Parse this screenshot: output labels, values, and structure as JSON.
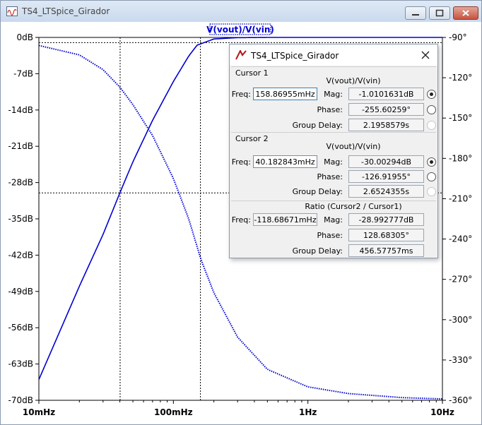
{
  "window": {
    "title": "TS4_LTSpice_Girador"
  },
  "plot": {
    "trace_label": "V(vout)/V(vin)",
    "trace_color": "#0000d0",
    "left_ticks": [
      "0dB",
      "-7dB",
      "-14dB",
      "-21dB",
      "-28dB",
      "-35dB",
      "-42dB",
      "-49dB",
      "-56dB",
      "-63dB",
      "-70dB"
    ],
    "right_ticks": [
      "-90°",
      "-120°",
      "-150°",
      "-180°",
      "-210°",
      "-240°",
      "-270°",
      "-300°",
      "-330°",
      "-360°"
    ],
    "x_ticks": [
      "10mHz",
      "100mHz",
      "1Hz",
      "10Hz"
    ],
    "cursor1_freq_hz": 0.15887,
    "cursor2_freq_hz": 0.04018
  },
  "chart_data": {
    "type": "line",
    "xscale": "log",
    "xlim": [
      0.01,
      10
    ],
    "ylim_left": [
      -70,
      0
    ],
    "ylim_right": [
      -360,
      -90
    ],
    "x_ticks": [
      "10mHz",
      "100mHz",
      "1Hz",
      "10Hz"
    ],
    "left_axis_ticks": [
      "0dB",
      "-7dB",
      "-14dB",
      "-21dB",
      "-28dB",
      "-35dB",
      "-42dB",
      "-49dB",
      "-56dB",
      "-63dB",
      "-70dB"
    ],
    "right_axis_ticks": [
      "-90°",
      "-120°",
      "-150°",
      "-180°",
      "-210°",
      "-240°",
      "-270°",
      "-300°",
      "-330°",
      "-360°"
    ],
    "series": [
      {
        "name": "V(vout)/V(vin)",
        "style": "solid",
        "axis": "left",
        "x": [
          0.01,
          0.02,
          0.03,
          0.04,
          0.05,
          0.07,
          0.1,
          0.13,
          0.15,
          0.2,
          0.3,
          0.5,
          1,
          10
        ],
        "y": [
          -66,
          -48,
          -38,
          -30,
          -24,
          -16,
          -8.5,
          -3.6,
          -1.5,
          -0.3,
          -0.05,
          0,
          0,
          0
        ]
      },
      {
        "name": "",
        "style": "dotted",
        "axis": "right",
        "x": [
          0.01,
          0.02,
          0.03,
          0.04,
          0.05,
          0.07,
          0.1,
          0.13,
          0.16,
          0.2,
          0.3,
          0.5,
          1,
          2,
          5,
          10
        ],
        "y": [
          -96,
          -103,
          -114,
          -127,
          -140,
          -163,
          -195,
          -225,
          -255,
          -280,
          -313,
          -337,
          -350,
          -355,
          -358,
          -359
        ]
      }
    ],
    "grid": false,
    "cursors": [
      {
        "name": "Cursor 1",
        "x": 0.15887,
        "y": -1.01
      },
      {
        "name": "Cursor 2",
        "x": 0.04018,
        "y": -30.0
      }
    ]
  },
  "dialog": {
    "title": "TS4_LTSpice_Girador",
    "close_label": "×",
    "cursor1": {
      "heading": "Cursor 1",
      "trace": "V(vout)/V(vin)",
      "freq_label": "Freq:",
      "freq": "158.86955mHz",
      "mag_label": "Mag:",
      "mag": "-1.0101631dB",
      "phase_label": "Phase:",
      "phase": "-255.60259°",
      "gd_label": "Group Delay:",
      "gd": "2.1958579s"
    },
    "cursor2": {
      "heading": "Cursor 2",
      "trace": "V(vout)/V(vin)",
      "freq_label": "Freq:",
      "freq": "40.182843mHz",
      "mag_label": "Mag:",
      "mag": "-30.00294dB",
      "phase_label": "Phase:",
      "phase": "-126.91955°",
      "gd_label": "Group Delay:",
      "gd": "2.6524355s"
    },
    "ratio": {
      "heading": "Ratio (Cursor2 / Cursor1)",
      "freq_label": "Freq:",
      "freq": "-118.68671mHz",
      "mag_label": "Mag:",
      "mag": "-28.992777dB",
      "phase_label": "Phase:",
      "phase": "128.68305°",
      "gd_label": "Group Delay:",
      "gd": "456.57757ms"
    }
  }
}
